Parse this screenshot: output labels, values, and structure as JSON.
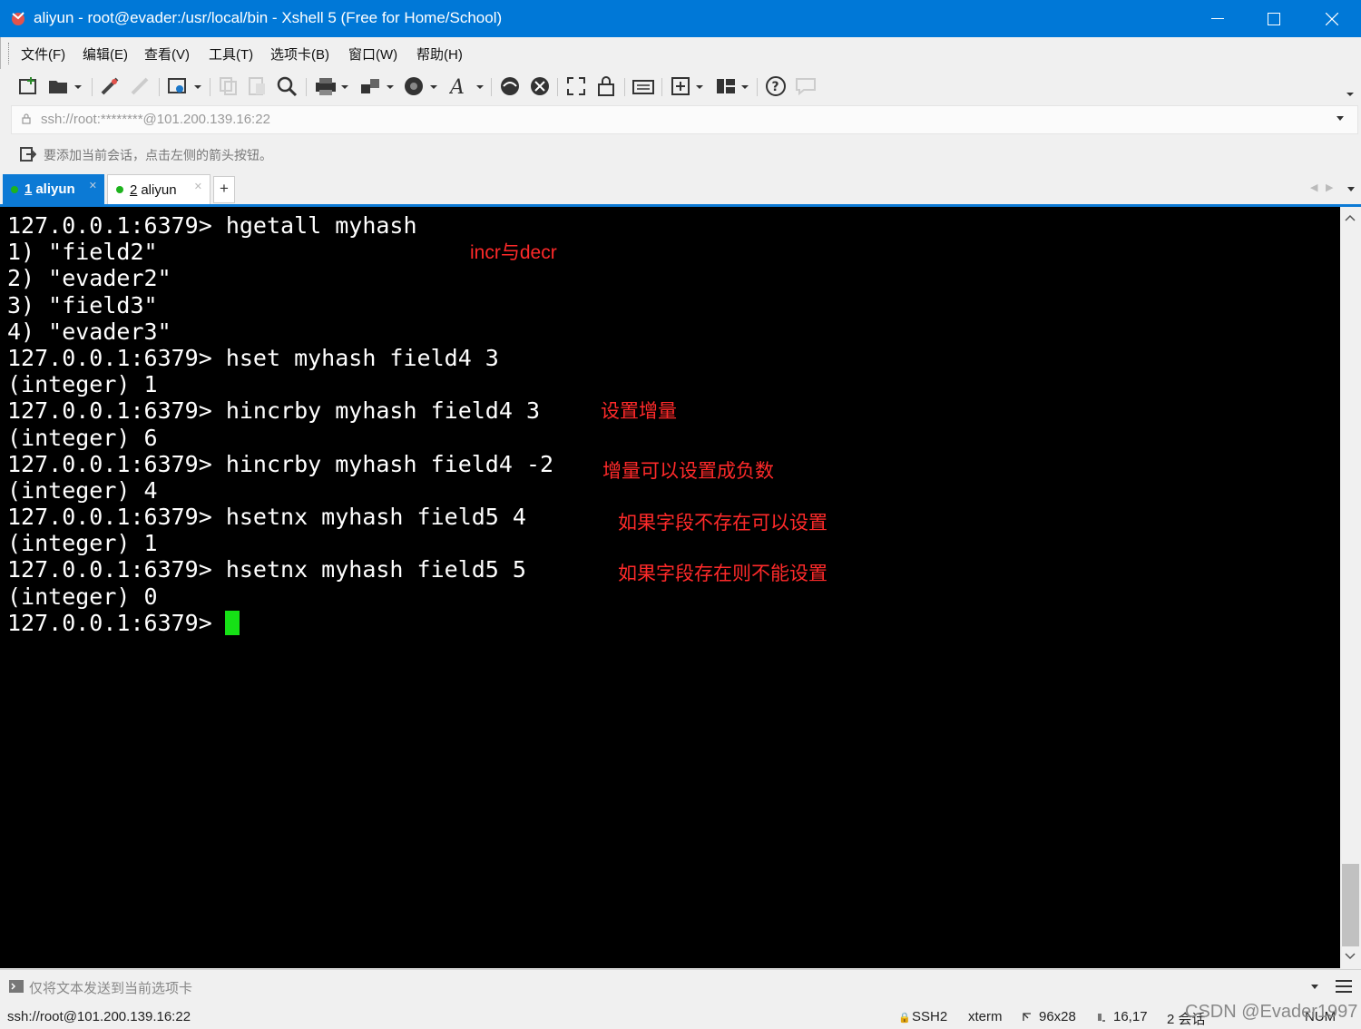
{
  "window": {
    "title": "aliyun - root@evader:/usr/local/bin - Xshell 5 (Free for Home/School)",
    "minimize_glyph": "—",
    "maximize_glyph": "☐",
    "close_glyph": "✕"
  },
  "menu": [
    "文件(F)",
    "编辑(E)",
    "查看(V)",
    "工具(T)",
    "选项卡(B)",
    "窗口(W)",
    "帮助(H)"
  ],
  "toolbar": {
    "icons": [
      "new-session-icon",
      "open-folder-icon",
      "reconnect-icon",
      "disconnect-icon",
      "properties-icon",
      "copy-icon",
      "paste-icon",
      "find-icon",
      "print-icon",
      "transfer-icon",
      "globe-icon",
      "font-icon",
      "xftp-icon",
      "xmanager-icon",
      "fullscreen-icon",
      "lock-icon",
      "keyboard-icon",
      "compose-icon",
      "layout-icon",
      "help-icon",
      "chat-icon"
    ]
  },
  "address": {
    "value": "ssh://root:********@101.200.139.16:22"
  },
  "hint": {
    "text": "要添加当前会话，点击左侧的箭头按钮。"
  },
  "tabs": [
    {
      "number": "1",
      "label": "aliyun",
      "active": true
    },
    {
      "number": "2",
      "label": "aliyun",
      "active": false
    }
  ],
  "tab_add": "+",
  "terminal": {
    "lines": [
      "127.0.0.1:6379> hgetall myhash",
      "1) \"field2\"",
      "2) \"evader2\"",
      "3) \"field3\"",
      "4) \"evader3\"",
      "127.0.0.1:6379> hset myhash field4 3",
      "(integer) 1",
      "127.0.0.1:6379> hincrby myhash field4 3",
      "(integer) 6",
      "127.0.0.1:6379> hincrby myhash field4 -2",
      "(integer) 4",
      "127.0.0.1:6379> hsetnx myhash field5 4",
      "(integer) 1",
      "127.0.0.1:6379> hsetnx myhash field5 5",
      "(integer) 0",
      "127.0.0.1:6379> "
    ],
    "cursor_color": "#16e116"
  },
  "annotations": {
    "a1": "incr与decr",
    "a2": "设置增量",
    "a3": "增量可以设置成负数",
    "a4": "如果字段不存在可以设置",
    "a5": "如果字段存在则不能设置"
  },
  "sendbar": {
    "text": "仅将文本发送到当前选项卡"
  },
  "status": {
    "connection": "ssh://root@101.200.139.16:22",
    "protocol": "SSH2",
    "terminal_type": "xterm",
    "size": "96x28",
    "cursor_pos": "16,17",
    "sessions": "2 会话",
    "numlock": "NUM"
  },
  "watermark": "CSDN @Evader1997",
  "colors": {
    "titlebar": "#0078d7",
    "tab_active": "#0c7ad5",
    "annotation": "#ff2a2a"
  }
}
